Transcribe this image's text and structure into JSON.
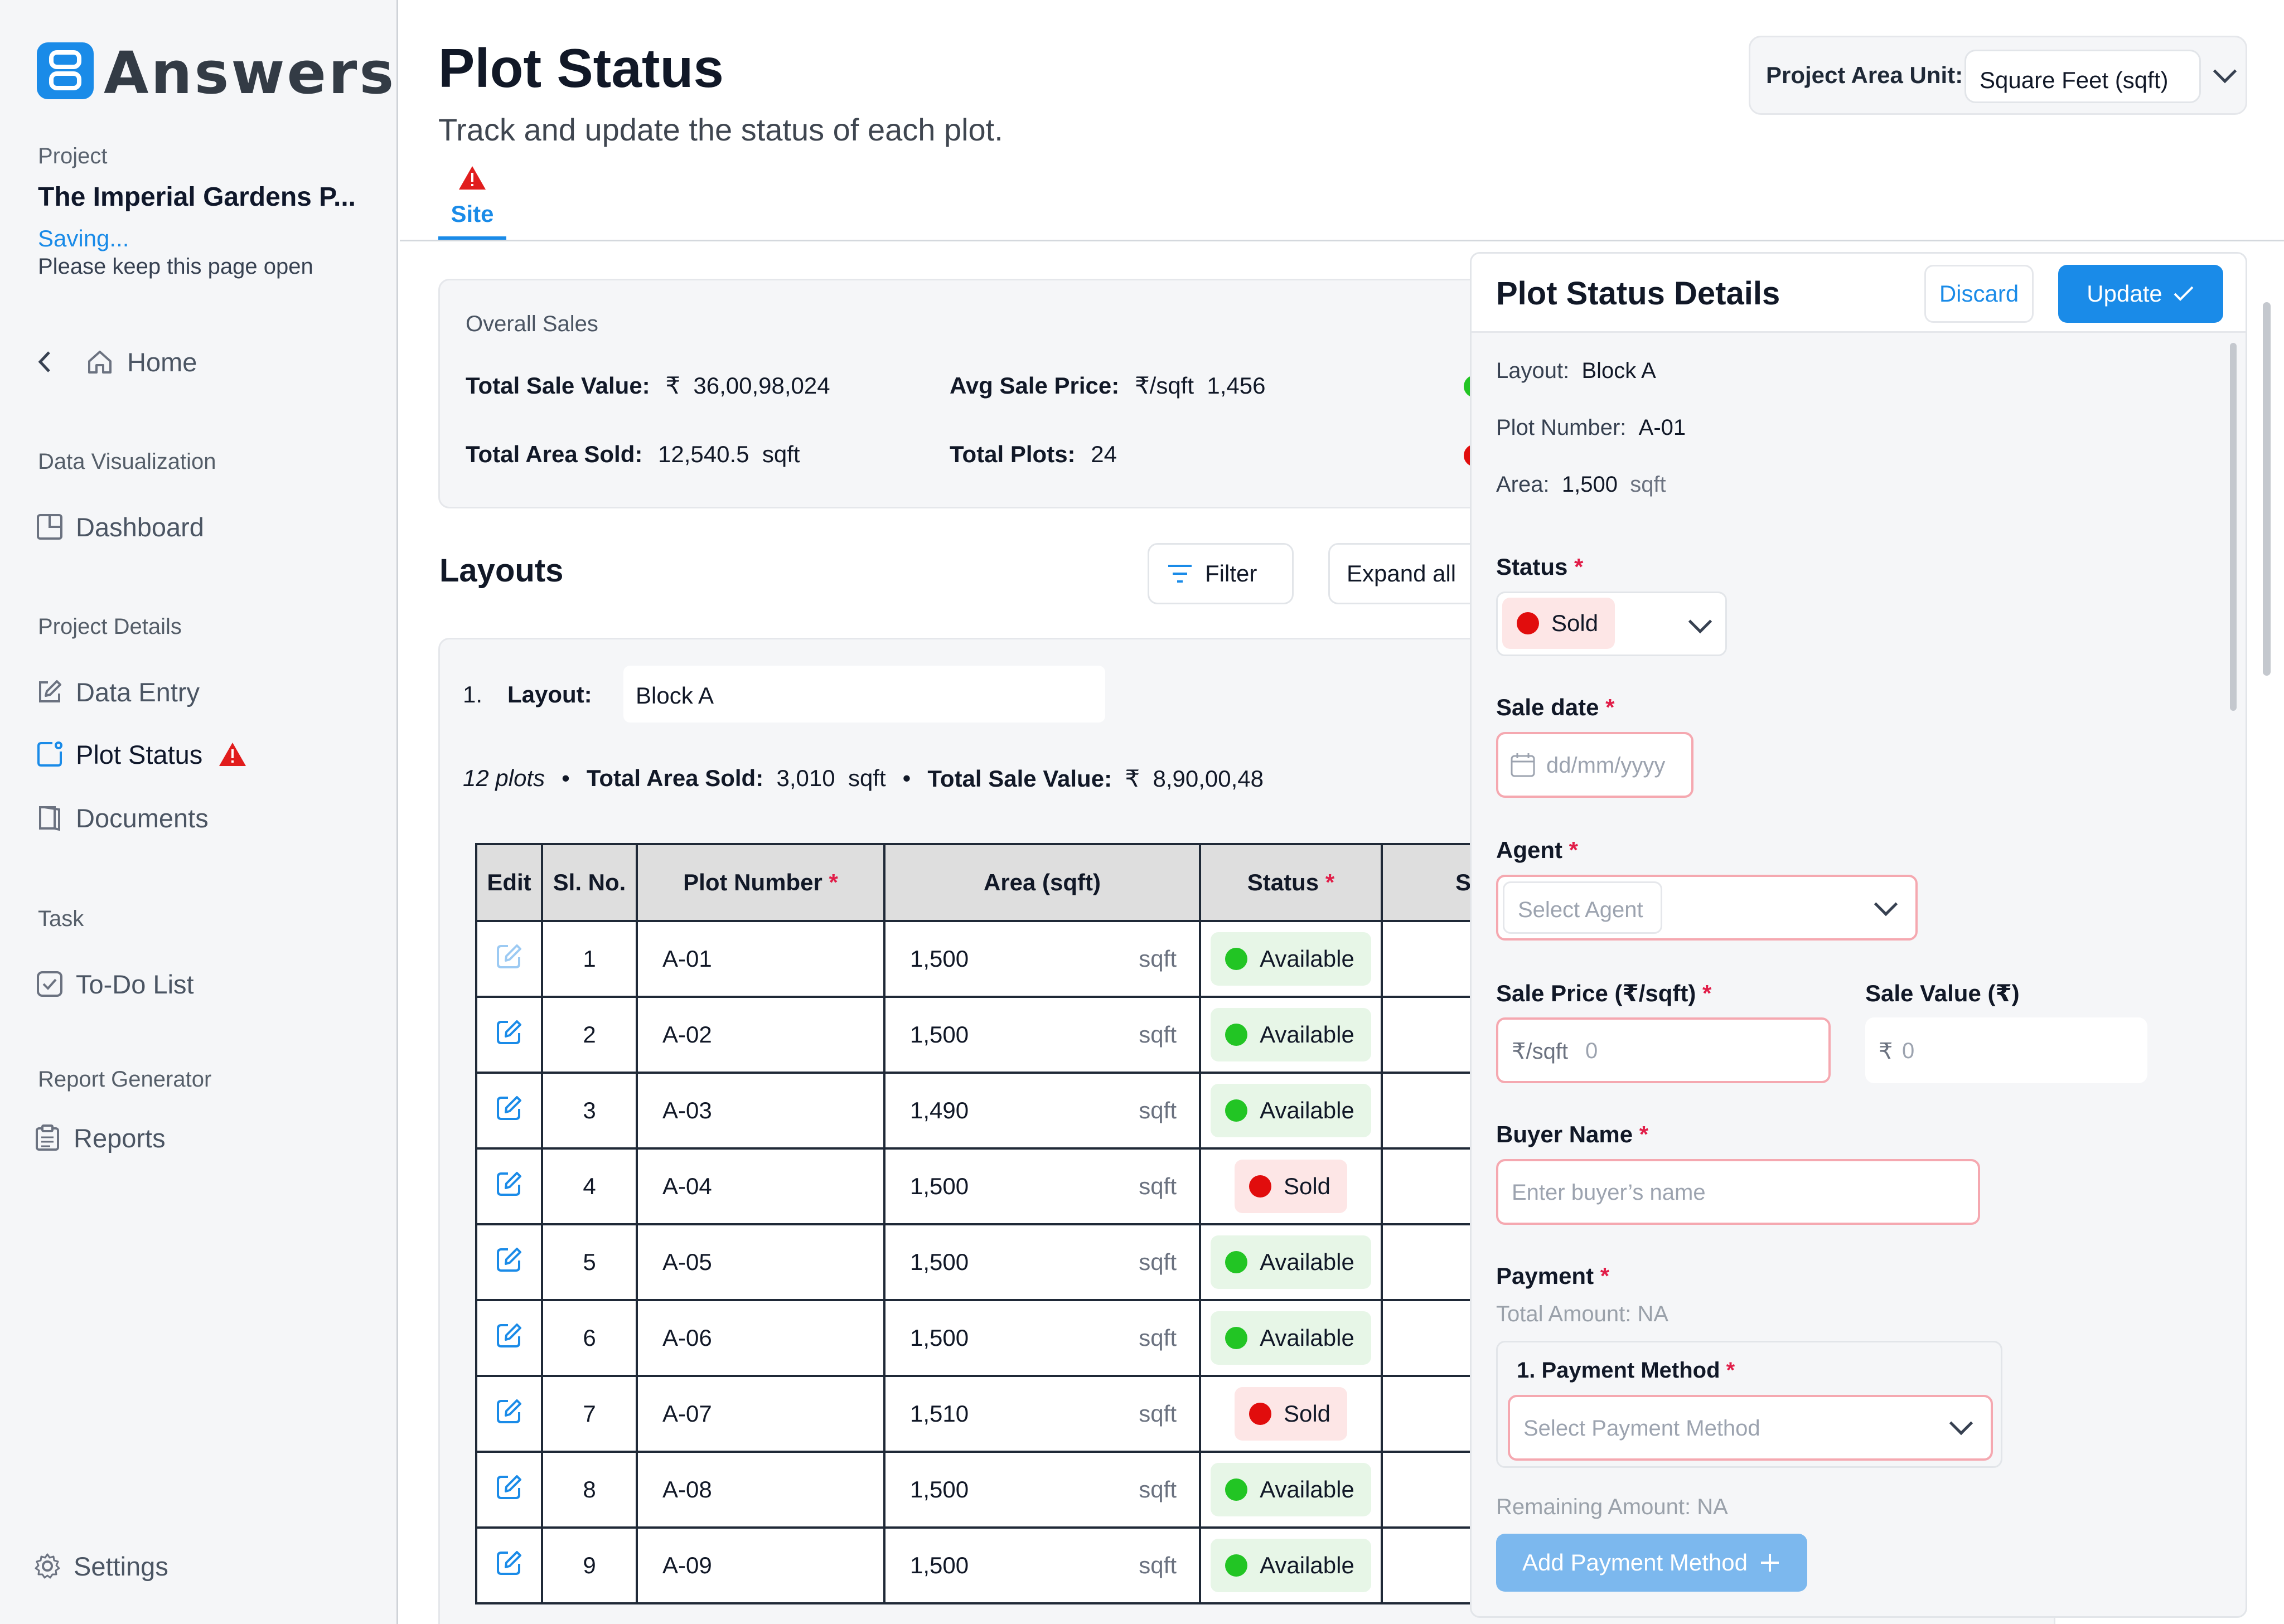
{
  "app": {
    "logo_text": "Answers"
  },
  "sidebar": {
    "project_label": "Project",
    "project_name": "The Imperial Gardens P...",
    "saving_text": "Saving...",
    "keep_open_text": "Please keep this page open",
    "home_label": "Home",
    "sections": {
      "data_visualization": "Data Visualization",
      "project_details": "Project Details",
      "task": "Task",
      "report_generator": "Report Generator"
    },
    "items": {
      "dashboard": "Dashboard",
      "data_entry": "Data Entry",
      "plot_status": "Plot Status",
      "documents": "Documents",
      "todo": "To-Do List",
      "reports": "Reports",
      "settings": "Settings"
    }
  },
  "header": {
    "title": "Plot Status",
    "subtitle": "Track and update the status of each plot.",
    "tab_site": "Site",
    "unit_label": "Project Area Unit:",
    "unit_value": "Square Feet (sqft)"
  },
  "overall_sales": {
    "title": "Overall Sales",
    "total_sale_value_label": "Total Sale Value:",
    "total_sale_value": "₹  36,00,98,024",
    "avg_sale_price_label": "Avg Sale Price:",
    "avg_sale_price": "₹/sqft  1,456",
    "total_area_sold_label": "Total Area Sold:",
    "total_area_sold": "12,540.5  sqft",
    "total_plots_label": "Total Plots:",
    "total_plots": "24"
  },
  "layouts": {
    "title": "Layouts",
    "filter_label": "Filter",
    "expand_label": "Expand all",
    "layout_index": "1.",
    "layout_label": "Layout:",
    "layout_name": "Block A",
    "summary_plots": "12 plots",
    "summary_area_label": "Total Area Sold:",
    "summary_area": "3,010  sqft",
    "summary_value_label": "Total Sale Value:",
    "summary_value": "₹  8,90,00,48"
  },
  "table": {
    "headers": {
      "edit": "Edit",
      "sl": "Sl. No.",
      "plot": "Plot Number",
      "area": "Area (sqft)",
      "status": "Status",
      "next": "S"
    },
    "required_mark": "*",
    "unit": "sqft",
    "rows": [
      {
        "sl": "1",
        "plot": "A-01",
        "area": "1,500",
        "status": "Available"
      },
      {
        "sl": "2",
        "plot": "A-02",
        "area": "1,500",
        "status": "Available"
      },
      {
        "sl": "3",
        "plot": "A-03",
        "area": "1,490",
        "status": "Available"
      },
      {
        "sl": "4",
        "plot": "A-04",
        "area": "1,500",
        "status": "Sold"
      },
      {
        "sl": "5",
        "plot": "A-05",
        "area": "1,500",
        "status": "Available"
      },
      {
        "sl": "6",
        "plot": "A-06",
        "area": "1,500",
        "status": "Available"
      },
      {
        "sl": "7",
        "plot": "A-07",
        "area": "1,510",
        "status": "Sold"
      },
      {
        "sl": "8",
        "plot": "A-08",
        "area": "1,500",
        "status": "Available"
      },
      {
        "sl": "9",
        "plot": "A-09",
        "area": "1,500",
        "status": "Available"
      }
    ]
  },
  "panel": {
    "title": "Plot Status Details",
    "discard_label": "Discard",
    "update_label": "Update",
    "layout_label": "Layout:",
    "layout_value": "Block A",
    "plot_number_label": "Plot Number:",
    "plot_number_value": "A-01",
    "area_label": "Area:",
    "area_value": "1,500",
    "area_unit": "sqft",
    "status_label": "Status",
    "status_value": "Sold",
    "sale_date_label": "Sale date",
    "sale_date_placeholder": "dd/mm/yyyy",
    "agent_label": "Agent",
    "agent_placeholder": "Select Agent",
    "sale_price_label": "Sale Price (₹/sqft)",
    "sale_price_prefix": "₹/sqft",
    "sale_price_placeholder": "0",
    "sale_value_label": "Sale Value (₹)",
    "sale_value_prefix": "₹",
    "sale_value_placeholder": "0",
    "buyer_label": "Buyer Name",
    "buyer_placeholder": "Enter buyer’s name",
    "payment_label": "Payment",
    "total_amount": "Total Amount: NA",
    "payment_method_label": "1. Payment Method",
    "payment_method_placeholder": "Select Payment Method",
    "remaining_amount": "Remaining Amount: NA",
    "add_payment_label": "Add Payment Method"
  },
  "colors": {
    "accent": "#1a8be8",
    "available": "#22c524",
    "sold": "#e10d0d",
    "warning": "#e11d1d"
  }
}
